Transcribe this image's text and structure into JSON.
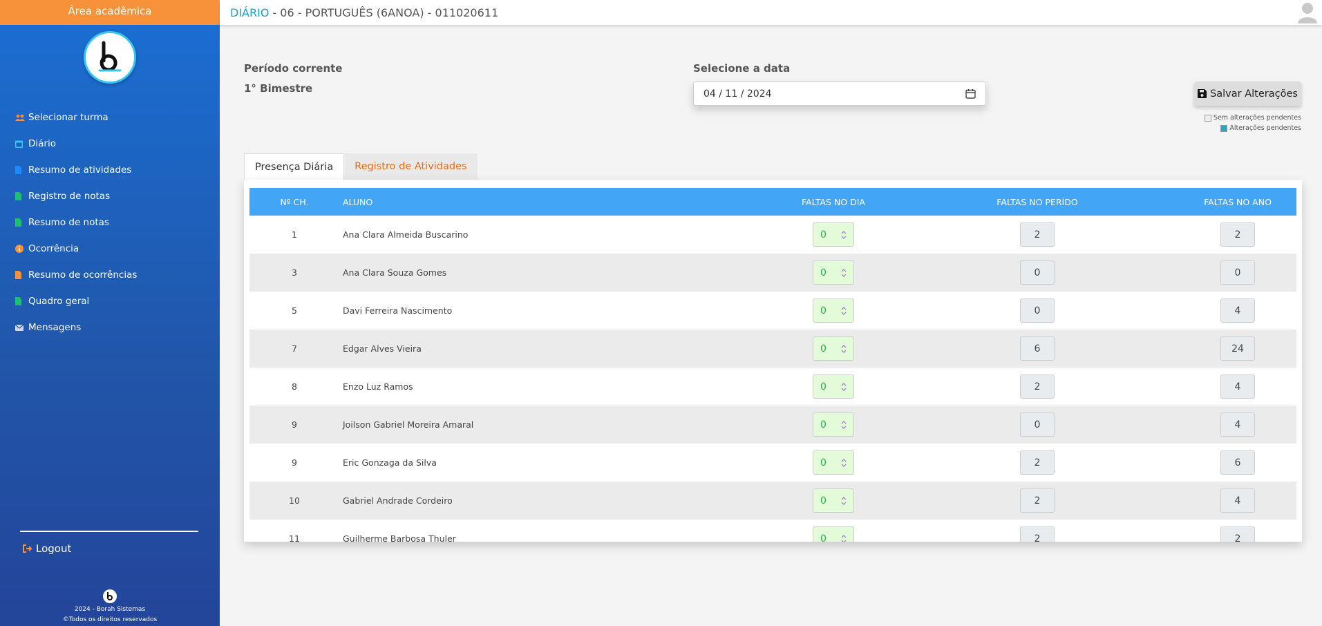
{
  "sidebar": {
    "header": "Área acadêmica",
    "menu": [
      {
        "label": "Selecionar turma",
        "icon": "users-icon",
        "color": "#f7923a"
      },
      {
        "label": "Diário",
        "icon": "calendar-icon",
        "color": "#35c5f0"
      },
      {
        "label": "Resumo de atividades",
        "icon": "book-icon",
        "color": "#1a8cff"
      },
      {
        "label": "Registro de notas",
        "icon": "file-icon",
        "color": "#1dbf73"
      },
      {
        "label": "Resumo de notas",
        "icon": "file-icon",
        "color": "#1dbf73"
      },
      {
        "label": "Ocorrência",
        "icon": "info-icon",
        "color": "#f7923a"
      },
      {
        "label": "Resumo de ocorrências",
        "icon": "file-icon",
        "color": "#f7923a"
      },
      {
        "label": "Quadro geral",
        "icon": "file-icon",
        "color": "#1dbf73"
      },
      {
        "label": "Mensagens",
        "icon": "envelope-icon",
        "color": "#cfd8e8"
      }
    ],
    "logout": "Logout",
    "footer_line1": "2024 - Borah Sistemas",
    "footer_line2": "©Todos os direitos reservados"
  },
  "topbar": {
    "section": "DIÁRIO",
    "title": "- 06 - PORTUGUÊS (6ANOA) - 011020611"
  },
  "period": {
    "label": "Período corrente",
    "value": "1° Bimestre"
  },
  "date": {
    "label": "Selecione a data",
    "value": "04 / 11 / 2024"
  },
  "save_button": "Salvar Alterações",
  "legend": {
    "no_changes": "Sem alterações pendentes",
    "changes": "Alterações pendentes"
  },
  "tabs": [
    {
      "label": "Presença Diária",
      "active": true
    },
    {
      "label": "Registro de Atividades",
      "active": false
    }
  ],
  "table": {
    "headers": [
      "Nº CH.",
      "ALUNO",
      "FALTAS NO DIA",
      "FALTAS NO PERÍDO",
      "FALTAS NO ANO"
    ],
    "rows": [
      {
        "num": "1",
        "name": "Ana Clara Almeida Buscarino",
        "dia": "0",
        "periodo": "2",
        "ano": "2"
      },
      {
        "num": "3",
        "name": "Ana Clara Souza Gomes",
        "dia": "0",
        "periodo": "0",
        "ano": "0"
      },
      {
        "num": "5",
        "name": "Davi Ferreira Nascimento",
        "dia": "0",
        "periodo": "0",
        "ano": "4"
      },
      {
        "num": "7",
        "name": "Edgar Alves Vieira",
        "dia": "0",
        "periodo": "6",
        "ano": "24"
      },
      {
        "num": "8",
        "name": "Enzo Luz Ramos",
        "dia": "0",
        "periodo": "2",
        "ano": "4"
      },
      {
        "num": "9",
        "name": "Joilson Gabriel Moreira Amaral",
        "dia": "0",
        "periodo": "0",
        "ano": "4"
      },
      {
        "num": "9",
        "name": "Eric Gonzaga da Silva",
        "dia": "0",
        "periodo": "2",
        "ano": "6"
      },
      {
        "num": "10",
        "name": "Gabriel Andrade Cordeiro",
        "dia": "0",
        "periodo": "2",
        "ano": "4"
      },
      {
        "num": "11",
        "name": "Guilherme Barbosa Thuler",
        "dia": "0",
        "periodo": "2",
        "ano": "2"
      }
    ]
  }
}
